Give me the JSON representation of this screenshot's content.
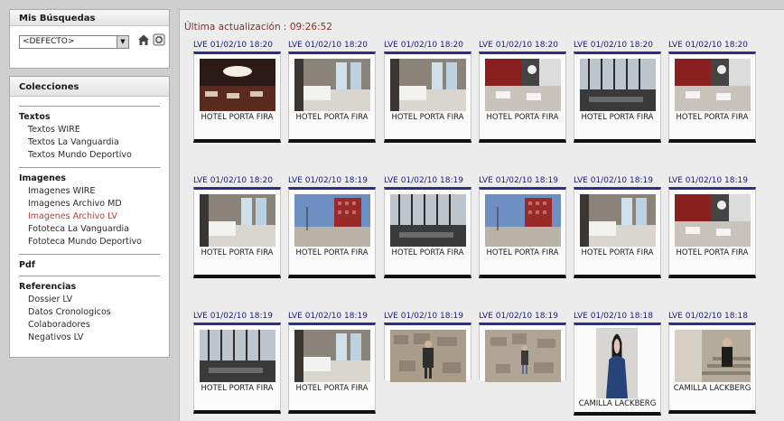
{
  "sidebar": {
    "search_title": "Mis Búsquedas",
    "search_select": "<DEFECTO>",
    "collections_title": "Colecciones",
    "sections": [
      {
        "title": "Textos",
        "items": [
          "Textos WIRE",
          "Textos La Vanguardia",
          "Textos Mundo Deportivo"
        ]
      },
      {
        "title": "Imagenes",
        "items": [
          "Imagenes WIRE",
          "Imagenes Archivo MD",
          "Imagenes Archivo LV",
          "Fototeca La Vanguardia",
          "Fototeca Mundo Deportivo"
        ]
      },
      {
        "title": "Pdf",
        "items": []
      },
      {
        "title": "Referencias",
        "items": [
          "Dossier LV",
          "Datos Cronologicos",
          "Colaboradores",
          "Negativos LV"
        ]
      }
    ],
    "active_item": "Imagenes Archivo LV"
  },
  "main": {
    "update_text": "Última actualización : 09:26:52",
    "cards": [
      {
        "stamp": "LVE 01/02/10 18:20",
        "caption": "HOTEL PORTA FIRA",
        "photo": "restaurant"
      },
      {
        "stamp": "LVE 01/02/10 18:20",
        "caption": "HOTEL PORTA FIRA",
        "photo": "bedroom"
      },
      {
        "stamp": "LVE 01/02/10 18:20",
        "caption": "HOTEL PORTA FIRA",
        "photo": "bedroom"
      },
      {
        "stamp": "LVE 01/02/10 18:20",
        "caption": "HOTEL PORTA FIRA",
        "photo": "red-dining"
      },
      {
        "stamp": "LVE 01/02/10 18:20",
        "caption": "HOTEL PORTA FIRA",
        "photo": "glass-hall"
      },
      {
        "stamp": "LVE 01/02/10 18:20",
        "caption": "HOTEL PORTA FIRA",
        "photo": "red-dining"
      },
      {
        "stamp": "LVE 01/02/10 18:20",
        "caption": "HOTEL PORTA FIRA",
        "photo": "bedroom"
      },
      {
        "stamp": "LVE 01/02/10 18:19",
        "caption": "HOTEL PORTA FIRA",
        "photo": "tower"
      },
      {
        "stamp": "LVE 01/02/10 18:19",
        "caption": "HOTEL PORTA FIRA",
        "photo": "glass-hall"
      },
      {
        "stamp": "LVE 01/02/10 18:19",
        "caption": "HOTEL PORTA FIRA",
        "photo": "tower"
      },
      {
        "stamp": "LVE 01/02/10 18:19",
        "caption": "HOTEL PORTA FIRA",
        "photo": "bedroom"
      },
      {
        "stamp": "LVE 01/02/10 18:19",
        "caption": "HOTEL PORTA FIRA",
        "photo": "red-dining"
      },
      {
        "stamp": "LVE 01/02/10 18:19",
        "caption": "HOTEL PORTA FIRA",
        "photo": "glass-hall"
      },
      {
        "stamp": "LVE 01/02/10 18:19",
        "caption": "HOTEL PORTA FIRA",
        "photo": "bedroom"
      },
      {
        "stamp": "LVE 01/02/10 18:19",
        "caption": "",
        "photo": "stone-man"
      },
      {
        "stamp": "LVE 01/02/10 18:19",
        "caption": "",
        "photo": "stone-man-small"
      },
      {
        "stamp": "LVE 01/02/10 18:18",
        "caption": "CAMILLA LACKBERG",
        "photo": "portrait"
      },
      {
        "stamp": "LVE 01/02/10 18:18",
        "caption": "CAMILLA LACKBERG",
        "photo": "stairs-woman"
      }
    ]
  }
}
